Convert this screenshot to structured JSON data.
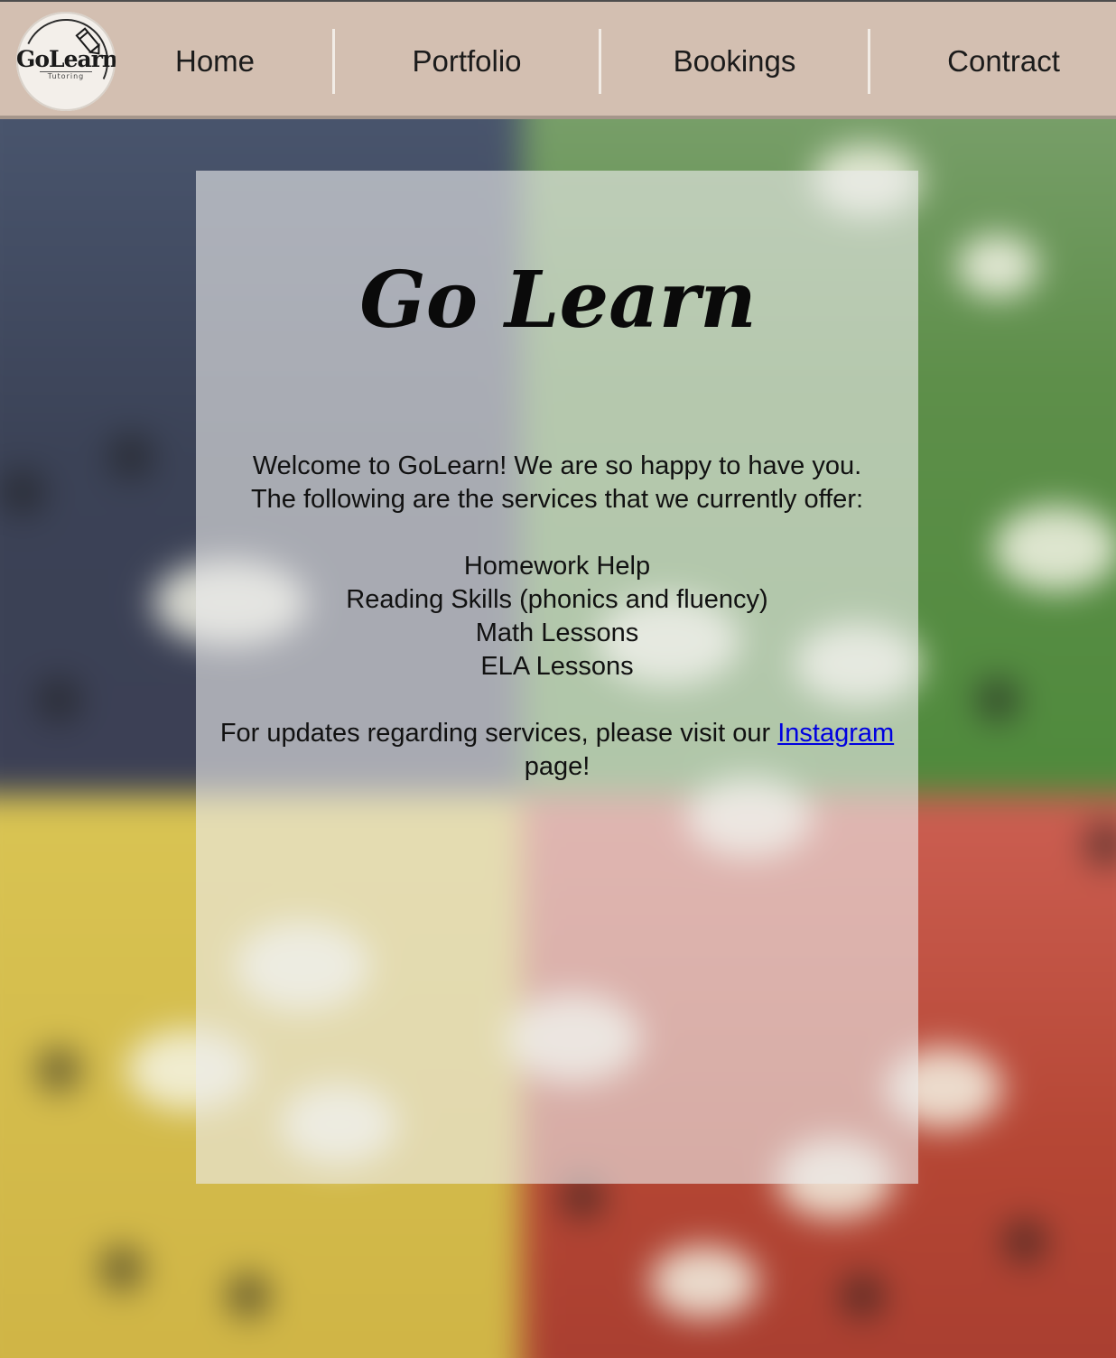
{
  "site": {
    "logo_alt": "GoLearn Tutoring logo",
    "logo_text": "GoLearn",
    "logo_subtext": "Tutoring"
  },
  "nav": {
    "items": [
      {
        "label": "Home"
      },
      {
        "label": "Portfolio"
      },
      {
        "label": "Bookings"
      },
      {
        "label": "Contract"
      }
    ]
  },
  "main": {
    "title": "Go Learn",
    "intro_line_1": "Welcome to GoLearn! We are so happy to have you.",
    "intro_line_2": "The following are the services that we currently offer:",
    "services": [
      "Homework Help",
      "Reading Skills (phonics and fluency)",
      "Math Lessons",
      "ELA Lessons"
    ],
    "updates_prefix": "For updates regarding services, please visit our",
    "updates_link": "Instagram",
    "updates_suffix": "page!"
  },
  "colors": {
    "header_bg": "#d3bfb1",
    "link": "#0000e0",
    "card_bg": "rgba(236,236,236,0.62)"
  }
}
